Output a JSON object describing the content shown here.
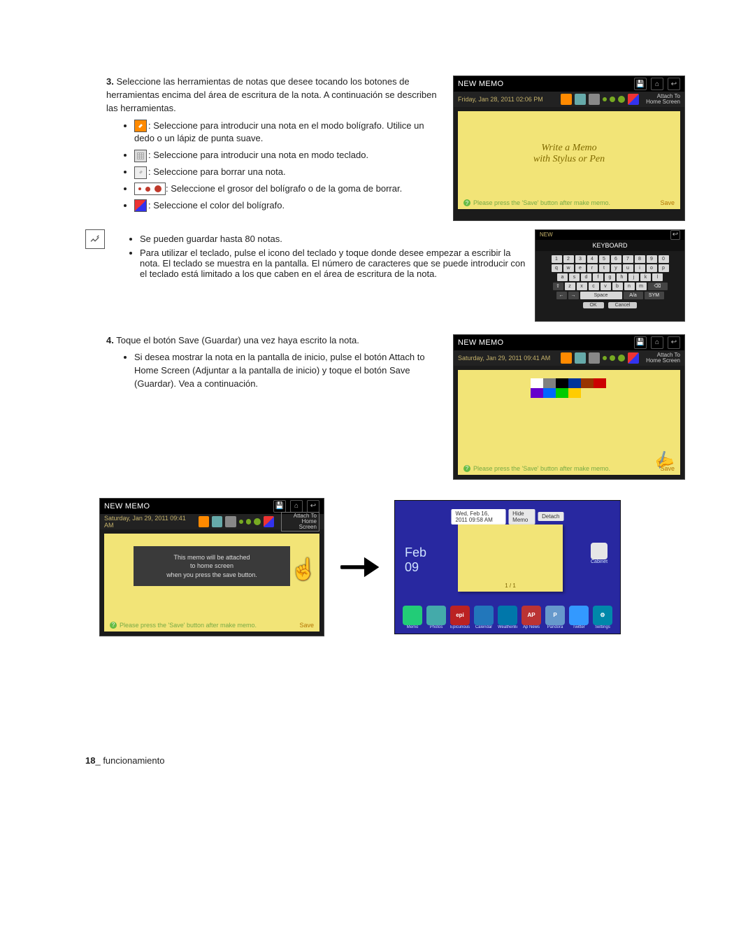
{
  "step3": {
    "num": "3.",
    "text": "Seleccione las herramientas de notas que desee tocando los botones de herramientas encima del área de escritura de la nota. A continuación se describen las herramientas.",
    "tools": {
      "pen": ": Seleccione para introducir una nota en el modo bolígrafo. Utilice un dedo o un lápiz de punta suave.",
      "kbd": ": Seleccione para introducir una nota en modo teclado.",
      "erase": ": Seleccione para borrar una nota.",
      "size": ": Seleccione el grosor del bolígrafo o de la goma de borrar.",
      "color": ": Seleccione el color del bolígrafo."
    }
  },
  "notes": {
    "n1": "Se pueden guardar hasta 80 notas.",
    "n2": "Para utilizar el teclado, pulse el icono del teclado y toque donde desee empezar a escribir la nota. El teclado se muestra en la pantalla. El número de caracteres que se puede introducir con el teclado está limitado a los que caben en el área de escritura de la nota."
  },
  "step4": {
    "num": "4.",
    "text": "Toque el botón Save (Guardar) una vez haya escrito la nota.",
    "sub": "Si desea mostrar la nota en la pantalla de inicio, pulse el botón Attach to Home Screen (Adjuntar a la pantalla de inicio) y toque el botón Save (Guardar). Vea a continuación."
  },
  "shot1": {
    "title": "NEW MEMO",
    "date": "Friday, Jan 28, 2011 02:06 PM",
    "attach": "Attach To\nHome Screen",
    "center1": "Write a Memo",
    "center2": "with Stylus or Pen",
    "hint": "Please press the 'Save' button after make memo.",
    "save": "Save"
  },
  "kb": {
    "title": "KEYBOARD",
    "row1": [
      "1",
      "2",
      "3",
      "4",
      "5",
      "6",
      "7",
      "8",
      "9",
      "0"
    ],
    "row2": [
      "q",
      "w",
      "e",
      "r",
      "t",
      "y",
      "u",
      "i",
      "o",
      "p"
    ],
    "row3": [
      "a",
      "s",
      "d",
      "f",
      "g",
      "h",
      "j",
      "k",
      "l"
    ],
    "row4_shift": "⇧",
    "row4": [
      "z",
      "x",
      "c",
      "v",
      "b",
      "n",
      "m"
    ],
    "row4_bs": "⌫",
    "row5_l": "←",
    "row5_r": "→",
    "row5_space": "Space",
    "row5_a": "A/a",
    "row5_sym": "SYM",
    "ok": "OK",
    "cancel": "Cancel"
  },
  "shot2": {
    "title": "NEW MEMO",
    "date": "Saturday, Jan 29, 2011 09:41 AM",
    "attach": "Attach To\nHome Screen",
    "hint": "Please press the 'Save' button after make memo.",
    "save": "Save",
    "palette": [
      "#ffffff",
      "#808080",
      "#000000",
      "#003399",
      "#993300",
      "#cc0000",
      "#6600cc",
      "#0066ff",
      "#00cc00",
      "#ffcc00"
    ]
  },
  "shot3": {
    "title": "NEW MEMO",
    "date": "Saturday, Jan 29, 2011 09:41 AM",
    "attach": "Attach To\nHome Screen",
    "msg1": "This memo will be attached",
    "msg2": "to home screen",
    "msg3": "when you press the save button.",
    "hint": "Please press the 'Save' button after make memo.",
    "save": "Save"
  },
  "home": {
    "dt": "Wed, Feb 16, 2011 09:58 AM",
    "hide": "Hide Memo",
    "detach": "Detach",
    "feb": "Feb",
    "day": "09",
    "page": "1 / 1",
    "cabinet": "Cabinet",
    "apps": [
      {
        "label": "Memo",
        "bg": "#2c7",
        "t": ""
      },
      {
        "label": "Photos",
        "bg": "#4aa",
        "t": ""
      },
      {
        "label": "Epicurious",
        "bg": "#b22",
        "t": "epi"
      },
      {
        "label": "Calendar",
        "bg": "#27b",
        "t": ""
      },
      {
        "label": "WeatherBug",
        "bg": "#07a",
        "t": ""
      },
      {
        "label": "Ap News",
        "bg": "#b33",
        "t": "AP"
      },
      {
        "label": "Pandora",
        "bg": "#69c",
        "t": "P"
      },
      {
        "label": "Twitter",
        "bg": "#39f",
        "t": ""
      },
      {
        "label": "Settings",
        "bg": "#08a",
        "t": "⚙"
      }
    ]
  },
  "footer": {
    "page": "18",
    "sep": "_ ",
    "section": "funcionamiento"
  }
}
